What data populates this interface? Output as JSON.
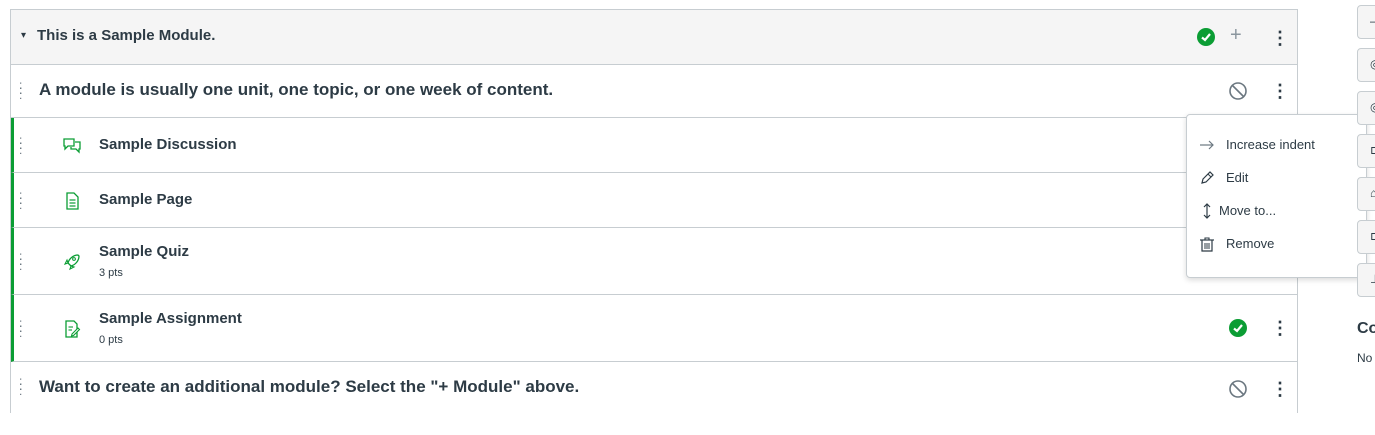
{
  "module": {
    "title": "This is a Sample Module.",
    "header_text": "A module is usually one unit, one topic, or one week of content.",
    "footer_text": "Want to create an additional module? Select the \"+ Module\" above.",
    "items": [
      {
        "title": "Sample Discussion",
        "icon": "discussion-icon",
        "sub": ""
      },
      {
        "title": "Sample Page",
        "icon": "page-icon",
        "sub": ""
      },
      {
        "title": "Sample Quiz",
        "icon": "quiz-icon",
        "sub": "3 pts"
      },
      {
        "title": "Sample Assignment",
        "icon": "assignment-icon",
        "sub": "0 pts"
      }
    ]
  },
  "menu": {
    "items": [
      {
        "label": "Increase indent",
        "icon": "arrow-right-icon"
      },
      {
        "label": "Edit",
        "icon": "pencil-icon"
      },
      {
        "label": "Move to...",
        "icon": "updown-arrow-icon"
      },
      {
        "label": "Remove",
        "icon": "trash-icon"
      }
    ]
  },
  "sidebar": {
    "title": "Co",
    "text": "No"
  },
  "colors": {
    "accent_green": "#0b9d34",
    "text": "#2d3b45",
    "border": "#c7cdd1"
  }
}
